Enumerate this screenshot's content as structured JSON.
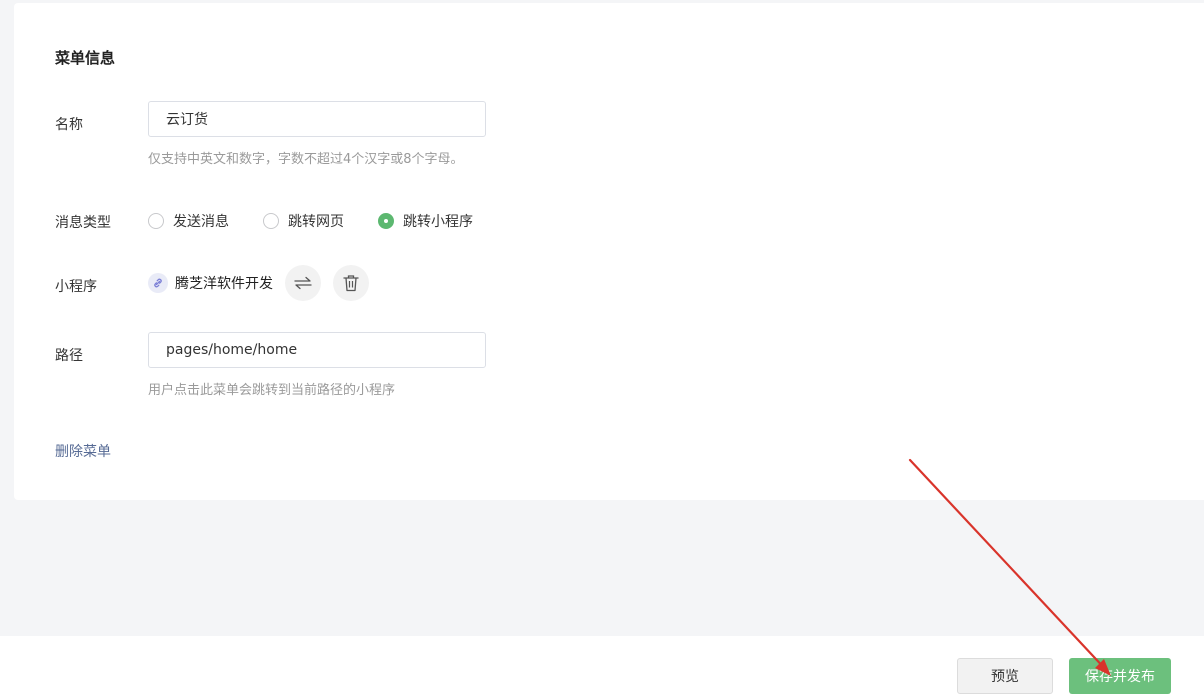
{
  "menu_info": {
    "title": "菜单信息",
    "name_label": "名称",
    "name_value": "云订货",
    "name_tip": "仅支持中英文和数字，字数不超过4个汉字或8个字母。",
    "msg_type_label": "消息类型",
    "msg_types": [
      {
        "label": "发送消息",
        "checked": false
      },
      {
        "label": "跳转网页",
        "checked": false
      },
      {
        "label": "跳转小程序",
        "checked": true
      }
    ],
    "mini_program_label": "小程序",
    "mini_program_name": "腾芝洋软件开发",
    "path_label": "路径",
    "path_value": "pages/home/home",
    "path_tip": "用户点击此菜单会跳转到当前路径的小程序",
    "delete_link": "删除菜单"
  },
  "footer": {
    "preview_label": "预览",
    "save_publish_label": "保存并发布"
  },
  "colors": {
    "accent_green": "#6cc07d",
    "link_blue": "#576b95",
    "annotation_arrow": "#d9342b"
  },
  "icons": [
    "link-icon",
    "swap-icon",
    "trash-icon",
    "annotation-arrow"
  ]
}
